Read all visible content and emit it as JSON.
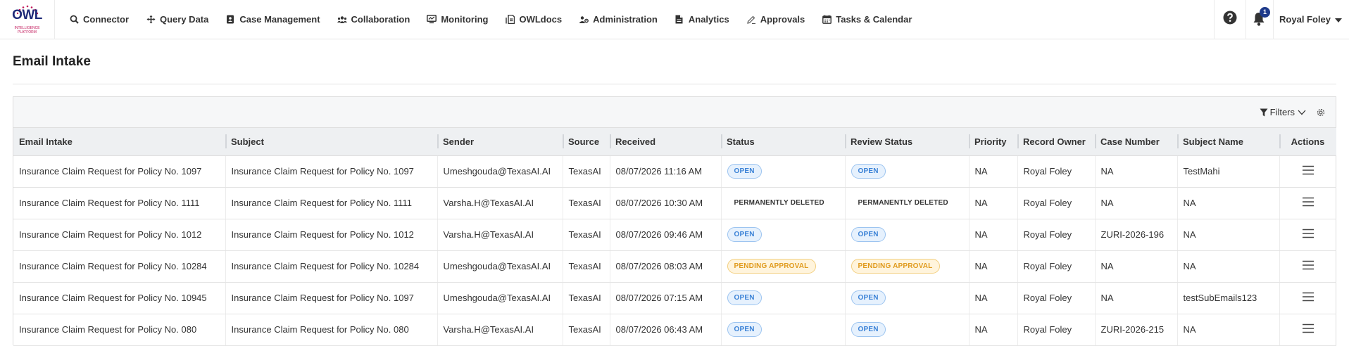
{
  "brand": {
    "logo_text": "OWL",
    "logo_subtext": "INTELLIGENCE PLATFORM"
  },
  "nav": {
    "items": [
      {
        "label": "Connector",
        "icon": "search-icon"
      },
      {
        "label": "Query Data",
        "icon": "arrows-icon"
      },
      {
        "label": "Case Management",
        "icon": "contact-book-icon"
      },
      {
        "label": "Collaboration",
        "icon": "users-icon"
      },
      {
        "label": "Monitoring",
        "icon": "monitor-icon"
      },
      {
        "label": "OWLdocs",
        "icon": "docs-icon"
      },
      {
        "label": "Administration",
        "icon": "users-cog-icon"
      },
      {
        "label": "Analytics",
        "icon": "file-icon"
      },
      {
        "label": "Approvals",
        "icon": "approval-icon"
      },
      {
        "label": "Tasks & Calendar",
        "icon": "calendar-icon"
      }
    ],
    "notification_count": "1",
    "user_name": "Royal Foley"
  },
  "page": {
    "title": "Email Intake"
  },
  "toolbar": {
    "filters_label": "Filters"
  },
  "table": {
    "columns": [
      "Email Intake",
      "Subject",
      "Sender",
      "Source",
      "Received",
      "Status",
      "Review Status",
      "Priority",
      "Record Owner",
      "Case Number",
      "Subject Name",
      "Actions"
    ],
    "rows": [
      {
        "email_intake": "Insurance Claim Request for Policy No. 1097",
        "subject": "Insurance Claim Request for Policy No. 1097",
        "sender": "Umeshgouda@TexasAI.AI",
        "source": "TexasAI",
        "received": "08/07/2026 11:16 AM",
        "status": "OPEN",
        "status_kind": "open",
        "review_status": "OPEN",
        "review_kind": "open",
        "priority": "NA",
        "record_owner": "Royal Foley",
        "case_number": "NA",
        "subject_name": "TestMahi"
      },
      {
        "email_intake": "Insurance Claim Request for Policy No. 1111",
        "subject": "Insurance Claim Request for Policy No. 1111",
        "sender": "Varsha.H@TexasAI.AI",
        "source": "TexasAI",
        "received": "08/07/2026 10:30 AM",
        "status": "PERMANENTLY DELETED",
        "status_kind": "deleted",
        "review_status": "PERMANENTLY DELETED",
        "review_kind": "deleted",
        "priority": "NA",
        "record_owner": "Royal Foley",
        "case_number": "NA",
        "subject_name": "NA"
      },
      {
        "email_intake": "Insurance Claim Request for Policy No. 1012",
        "subject": "Insurance Claim Request for Policy No. 1012",
        "sender": "Varsha.H@TexasAI.AI",
        "source": "TexasAI",
        "received": "08/07/2026 09:46 AM",
        "status": "OPEN",
        "status_kind": "open",
        "review_status": "OPEN",
        "review_kind": "open",
        "priority": "NA",
        "record_owner": "Royal Foley",
        "case_number": "ZURI-2026-196",
        "subject_name": "NA"
      },
      {
        "email_intake": "Insurance Claim Request for Policy No. 10284",
        "subject": "Insurance Claim Request for Policy No. 10284",
        "sender": "Umeshgouda@TexasAI.AI",
        "source": "TexasAI",
        "received": "08/07/2026 08:03 AM",
        "status": "PENDING APPROVAL",
        "status_kind": "pending",
        "review_status": "PENDING APPROVAL",
        "review_kind": "pending",
        "priority": "NA",
        "record_owner": "Royal Foley",
        "case_number": "NA",
        "subject_name": "NA"
      },
      {
        "email_intake": "Insurance Claim Request for Policy No. 10945",
        "subject": "Insurance Claim Request for Policy No. 1097",
        "sender": "Umeshgouda@TexasAI.AI",
        "source": "TexasAI",
        "received": "08/07/2026 07:15 AM",
        "status": "OPEN",
        "status_kind": "open",
        "review_status": "OPEN",
        "review_kind": "open",
        "priority": "NA",
        "record_owner": "Royal Foley",
        "case_number": "NA",
        "subject_name": "testSubEmails123"
      },
      {
        "email_intake": "Insurance Claim Request for Policy No. 080",
        "subject": "Insurance Claim Request for Policy No. 080",
        "sender": "Varsha.H@TexasAI.AI",
        "source": "TexasAI",
        "received": "08/07/2026 06:43 AM",
        "status": "OPEN",
        "status_kind": "open",
        "review_status": "OPEN",
        "review_kind": "open",
        "priority": "NA",
        "record_owner": "Royal Foley",
        "case_number": "ZURI-2026-215",
        "subject_name": "NA"
      }
    ]
  },
  "colors": {
    "open_text": "#3b82d6",
    "pending_text": "#e09b1e",
    "badge": "#1e3a8a",
    "logo_blue": "#1e2a78",
    "logo_accent": "#c2185b"
  }
}
